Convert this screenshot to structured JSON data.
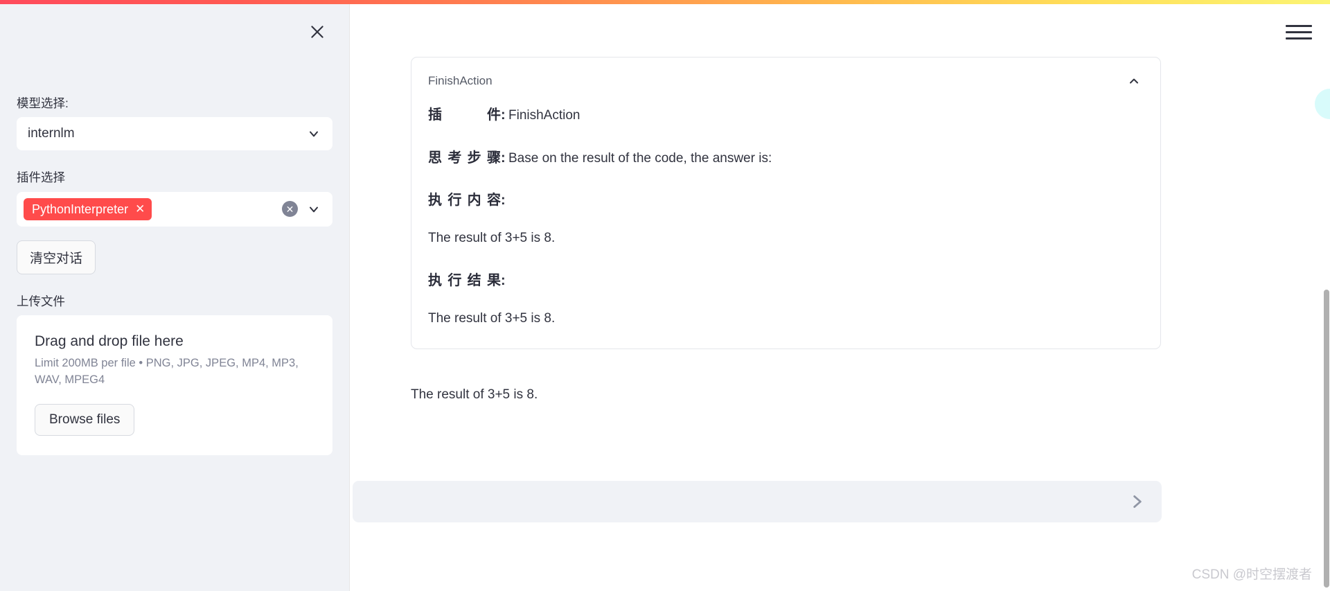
{
  "topbar": {
    "gradient_from": "#ff4b5c",
    "gradient_mid": "#ffb84d",
    "gradient_to": "#fbf474"
  },
  "sidebar": {
    "close_icon": "close-icon",
    "model_section": {
      "label": "模型选择:",
      "selected_value": "internlm",
      "chevron_icon": "chevron-down-icon"
    },
    "plugin_section": {
      "label": "插件选择",
      "tags": [
        {
          "label": "PythonInterpreter",
          "remove_icon": "x-icon",
          "color": "#ff4b4b"
        }
      ],
      "clear_icon": "clear-circle-icon",
      "chevron_icon": "chevron-down-icon"
    },
    "clear_chat_button": "清空对话",
    "upload_section": {
      "label": "上传文件",
      "drag_title": "Drag and drop file here",
      "limit_text": "Limit 200MB per file • PNG, JPG, JPEG, MP4, MP3, WAV, MPEG4",
      "browse_button": "Browse files"
    }
  },
  "main": {
    "menu_icon": "hamburger-menu-icon",
    "card": {
      "title": "FinishAction",
      "collapse_icon": "chevron-up-icon",
      "rows": [
        {
          "key": "插件",
          "value": "FinishAction"
        },
        {
          "key": "思考步骤",
          "value": "Base on the result of the code, the answer is:"
        },
        {
          "key": "执行内容",
          "value": ""
        }
      ],
      "exec_content_text": "The result of 3+5 is 8.",
      "result_key": "执行结果",
      "exec_result_text": "The result of 3+5 is 8."
    },
    "answer_text": "The result of 3+5 is 8.",
    "chat_input": {
      "value": "",
      "placeholder": "",
      "send_icon": "send-icon"
    }
  },
  "watermark": "CSDN @时空摆渡者"
}
